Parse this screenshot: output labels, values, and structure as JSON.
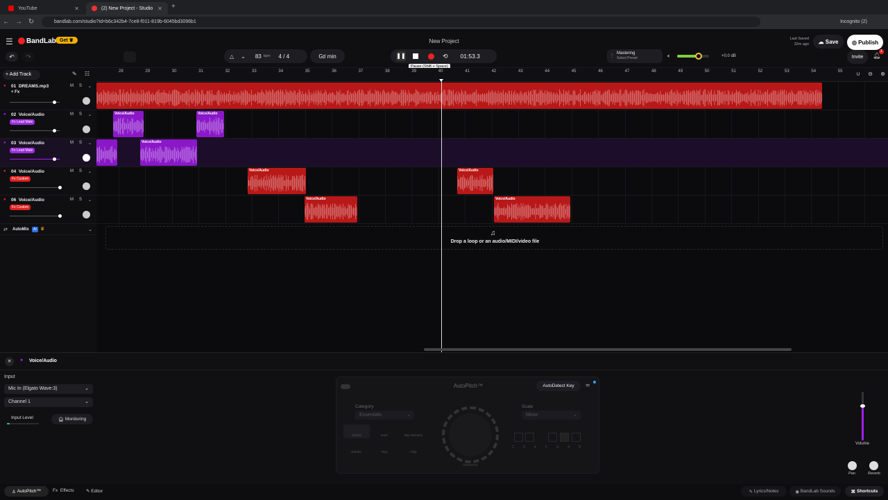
{
  "browser": {
    "tabs": [
      {
        "title": "YouTube",
        "active": false
      },
      {
        "title": "(2) New Project - Studio",
        "active": true
      }
    ],
    "url": "bandlab.com/studio?id=b6c342b4-7ce8-f011-819b-6045bd3096b1",
    "incognito": "Incognito (2)"
  },
  "header": {
    "logo": "BandLab",
    "get": "Get",
    "project_title": "New Project",
    "tempo": "83",
    "bpm": "bpm",
    "time_sig_num": "4",
    "time_sig_sep": "/",
    "time_sig_den": "4",
    "key": "G♯ min",
    "time": "01:53.3",
    "tooltip": "Pause (Shift + Space)",
    "mastering": "Mastering",
    "select_preset": "Select Preset",
    "volume_db": "+0.0 dB",
    "last_saved": "Last Saved",
    "last_saved_time": "32m ago",
    "save": "Save",
    "publish": "Publish",
    "invite": "Invite",
    "notif_count": "1"
  },
  "tracks_panel": {
    "add_track": "Add Track",
    "automix": "AutoMix",
    "ai": "AI"
  },
  "ruler": {
    "bars": [
      "28",
      "29",
      "30",
      "31",
      "32",
      "33",
      "34",
      "35",
      "36",
      "37",
      "38",
      "39",
      "40",
      "41",
      "42",
      "43",
      "44",
      "45",
      "46",
      "47",
      "48",
      "49",
      "50",
      "51",
      "52",
      "53",
      "54",
      "55"
    ]
  },
  "tracks": [
    {
      "num": "01",
      "name": "DREAMS.mp3",
      "tag": "+ Fx",
      "tag_color": "",
      "color": "#e02020"
    },
    {
      "num": "02",
      "name": "Voice/Audio",
      "tag": "Fx Lead Male",
      "tag_color": "#9b2de0",
      "color": "#a020f0"
    },
    {
      "num": "03",
      "name": "Voice/Audio",
      "tag": "Fx Lead Male",
      "tag_color": "#9b2de0",
      "color": "#a020f0"
    },
    {
      "num": "04",
      "name": "Voice/Audio",
      "tag": "Fx Custom",
      "tag_color": "#e02020",
      "color": "#e02020"
    },
    {
      "num": "06",
      "name": "Voice/Audio",
      "tag": "Fx Custom",
      "tag_color": "#e02020",
      "color": "#e02020"
    }
  ],
  "clip_label": "Voice/Audio",
  "drop_zone": "Drop a loop or an audio/MIDI/video file",
  "bottom": {
    "track_name": "Voice/Audio",
    "input_label": "Input",
    "input_device": "Mic In (Elgato Wave:3)",
    "channel": "Channel 1",
    "input_level": "Input Level",
    "monitoring": "Monitoring",
    "plugin_name": "AutoPitch™",
    "autodetect": "AutoDetect Key",
    "category_label": "Category",
    "category_value": "Essentials",
    "scale_label": "Scale",
    "scale_value": "Minor",
    "effects": [
      "Classic",
      "Duet",
      "Big Harmony",
      "Robotic",
      "Tripy",
      "Chip"
    ],
    "knob_label": "Heaviest",
    "keys": [
      "C",
      "D",
      "E",
      "F",
      "G",
      "A",
      "B"
    ],
    "volume": "Volume",
    "pan": "Pan",
    "reverb": "Reverb",
    "tabs": [
      "AutoPitch™",
      "Effects",
      "Editor"
    ],
    "fx_prefix": "Fx",
    "lyrics": "Lyrics/Notes",
    "sounds": "BandLab Sounds",
    "shortcuts": "Shortcuts"
  },
  "colors": {
    "accent_red": "#e02020",
    "accent_purple": "#a020f0",
    "gold": "#f0b000"
  }
}
